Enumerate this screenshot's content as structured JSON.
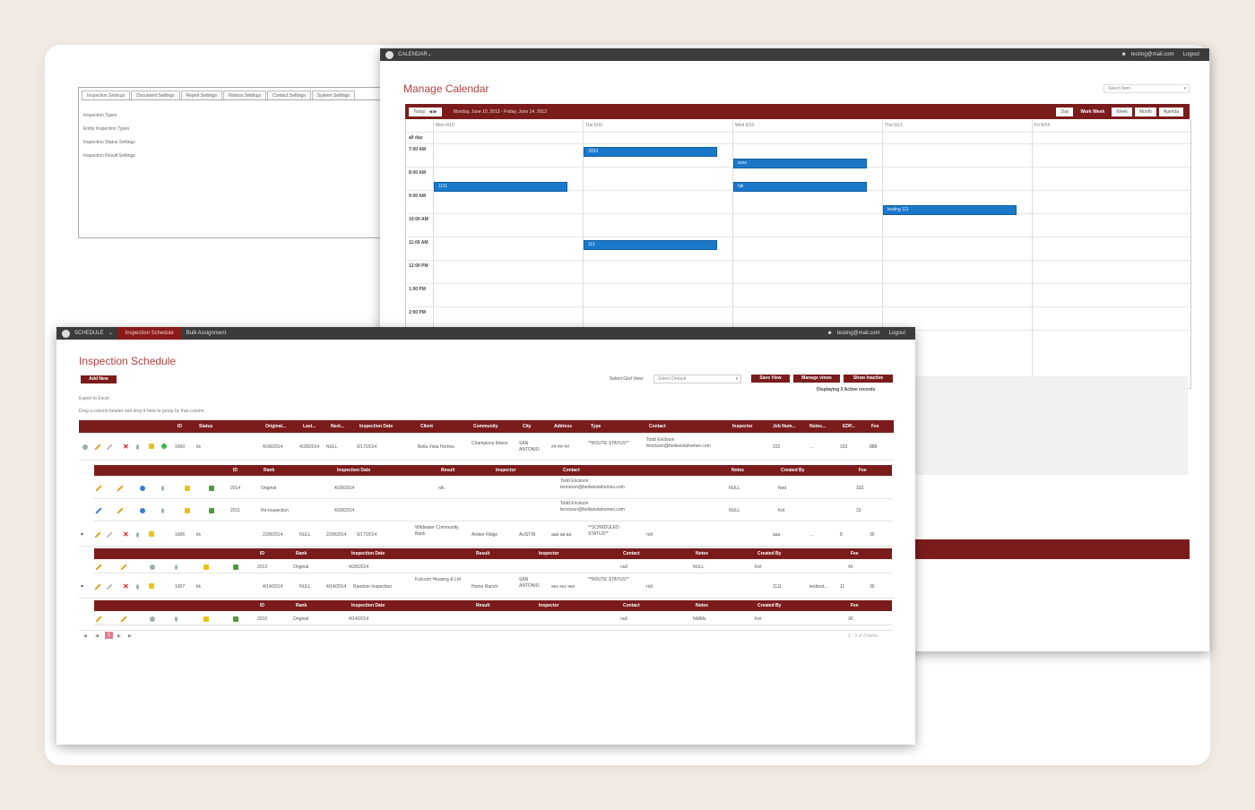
{
  "settings": {
    "tabs": [
      "Inspection Settings",
      "Document Settings",
      "Report Settings",
      "Notices Settings",
      "Contact Settings",
      "System Settings"
    ],
    "items": [
      "Inspection Types",
      "Entity Inspection Types",
      "Inspection Status Settings",
      "Inspection Result Settings"
    ]
  },
  "calendar": {
    "app": "CALENDAR",
    "user": "testing@mail.com",
    "logout": "Logout",
    "title": "Manage Calendar",
    "select": "Select Item",
    "today": "Today",
    "range": "Monday, June 10, 2013 - Friday, June 14, 2013",
    "views": [
      "Day",
      "Work Week",
      "Week",
      "Month",
      "Agenda"
    ],
    "days": [
      "Mon 6/10",
      "Tue 6/11",
      "Wed 6/12",
      "Thu 6/13",
      "Fri 6/14"
    ],
    "times": [
      "all day",
      "7:00 AM",
      "8:00 AM",
      "9:00 AM",
      "10:00 AM",
      "11:00 AM",
      "12:00 PM",
      "1:00 PM",
      "2:00 PM"
    ],
    "events": [
      "3333",
      "ssss",
      "1111",
      "hjk",
      "testing 111",
      "111"
    ]
  },
  "schedule": {
    "app": "SCHEDULE",
    "tabs": [
      "Inspection Schedule",
      "Bulk Assignment"
    ],
    "user": "testing@mail.com",
    "logout": "Logout",
    "title": "Inspection Schedule",
    "add": "Add New",
    "export": "Export to Excel",
    "hint": "Drag a column header and drop it here to group by that column",
    "view_label": "Select Grid View:",
    "view_value": "Select Default",
    "save_view": "Save View",
    "manage_views": "Manage views",
    "show_inactive": "Show Inactive",
    "records": "Displaying 3 Active records",
    "columns": [
      "ID",
      "Status",
      "Original...",
      "Last...",
      "Next...",
      "Inspection Date",
      "Client",
      "Community",
      "City",
      "Address",
      "Type",
      "Contact",
      "Inspector",
      "Job Num...",
      "Notes...",
      "EDP...",
      "Fee"
    ],
    "sub_columns": [
      "ID",
      "Rank",
      "Inspection Date",
      "Result",
      "Inspector",
      "Contact",
      "Notes",
      "Created By",
      "Fee"
    ],
    "rows": [
      {
        "id": "1000",
        "status": "kk",
        "original": "4/28/2014",
        "last": "4/28/2014",
        "next": "NULL",
        "date": "6/17/2014",
        "client": "Bella Vista Homes",
        "community": "Champions Manor",
        "city": "SAN ANTONIO",
        "address": "##-##-##",
        "type": "**ROUTE STATUS**",
        "contact": "Todd Erickson terickson@bellavistahomes.com",
        "inspector": "",
        "job": "222",
        "notes": "...",
        "edp": "333",
        "fee": "888",
        "sub": [
          {
            "id": "2014",
            "rank": "Original",
            "date": "4/28/2014",
            "result": "n/k",
            "contact": "Todd Erickson terickson@bellavistahomes.com",
            "notes": "NULL",
            "created": "Ned",
            "fee": "333"
          },
          {
            "id": "2011",
            "rank": "Re-Inspection",
            "date": "4/28/2014",
            "result": "",
            "contact": "Todd Erickson terickson@bellavistahomes.com",
            "notes": "NULL",
            "created": "Ket",
            "fee": "33"
          }
        ]
      },
      {
        "id": "1006",
        "status": "kk",
        "original": "2/28/2014",
        "last": "NULL",
        "next": "2/28/2014",
        "date": "6/17/2014",
        "client": "Wildwater Community Bank",
        "community": "Amber Ridge",
        "city": "AUSTIN",
        "address": "aaa aa aa",
        "type": "**SCHEDULED STATUS**",
        "contact": "n/d",
        "inspector": "",
        "job": "aaa",
        "notes": "...",
        "edp": "8",
        "fee": "30",
        "sub": [
          {
            "id": "2013",
            "rank": "Original",
            "date": "4/28/2014",
            "result": "",
            "contact": "null",
            "notes": "NULL",
            "created": "Ket",
            "fee": "40"
          }
        ]
      },
      {
        "id": "1007",
        "status": "kk",
        "original": "4/14/2014",
        "last": "NULL",
        "next": "4/14/2014",
        "date": "Random Inspection",
        "client": "Fulcrum Housing & Ltd",
        "community": "Home Ranch",
        "city": "SAN ANTONIO",
        "address": "ses ses ses",
        "type": "**ROUTE STATUS**",
        "contact": "n/d",
        "inspector": "",
        "job": "1111",
        "notes": "testtest...",
        "edp": "11",
        "fee": "30",
        "sub": [
          {
            "id": "2010",
            "rank": "Original",
            "date": "4/14/2014",
            "result": "",
            "contact": "null",
            "notes": "NMMs",
            "created": "Ket",
            "fee": "30"
          }
        ]
      }
    ],
    "pager": {
      "page": "1",
      "summary": "1 - 3 of 3 items"
    }
  }
}
